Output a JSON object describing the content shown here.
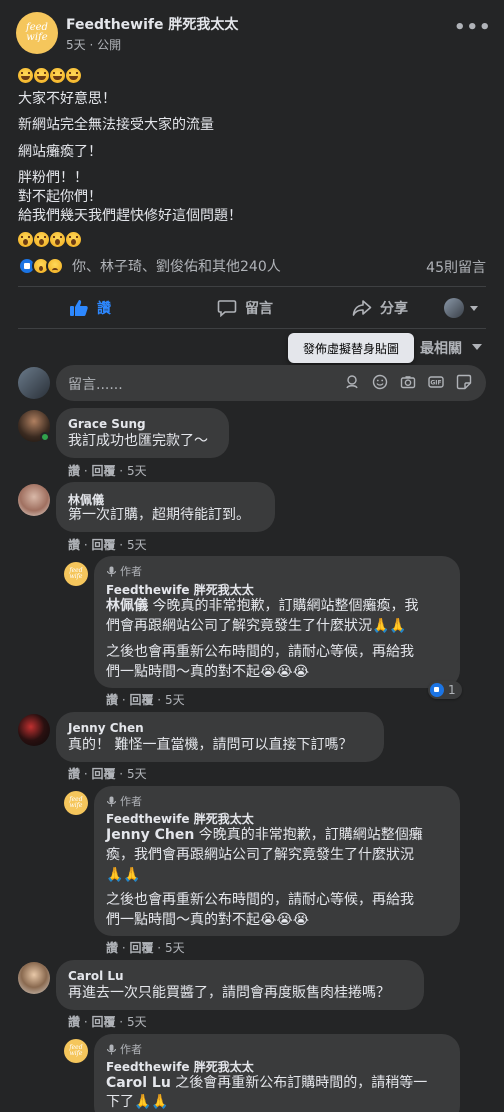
{
  "post": {
    "author": "Feedthewife 胖死我太太",
    "logo_text": [
      "feed",
      "wife"
    ],
    "meta": "5天 · 公開",
    "more": "•••",
    "lines": [
      "大家不好意思！",
      "新網站完全無法接受大家的流量",
      "網站癱瘓了！",
      "胖粉們！！",
      "對不起你們！",
      "給我們幾天我們趕快修好這個問題！"
    ],
    "emoji_top": [
      "laugh-emoji",
      "laugh-emoji",
      "laugh-emoji",
      "laugh-emoji"
    ],
    "emoji_bottom": [
      "wow-emoji",
      "wow-emoji",
      "wow-emoji",
      "wow-emoji"
    ],
    "reactions": {
      "icons": [
        "like-icon",
        "wow-icon",
        "sad-icon"
      ],
      "names": "你、林子琦、劉俊佑和其他240人",
      "comments": "45則留言"
    }
  },
  "actions": {
    "like": "讚",
    "comment": "留言",
    "share": "分享"
  },
  "tooltip": "發佈虛擬替身貼圖",
  "sort_label": "最相關",
  "composer": {
    "placeholder": "留言......"
  },
  "comments": [
    {
      "name": "Grace Sung",
      "text": "我訂成功也匯完款了～",
      "like": "讚",
      "reply": "回覆",
      "time": "5天"
    },
    {
      "name": "林佩儀",
      "text": "第一次訂購，超期待能訂到。",
      "like": "讚",
      "reply": "回覆",
      "time": "5天",
      "reply_item": {
        "badge": "作者",
        "name": "Feedthewife 胖死我太太",
        "mention": "林佩儀",
        "text1": " 今晚真的非常抱歉，訂購網站整個癱瘓，我",
        "text2": "們會再跟網站公司了解究竟發生了什麼狀況🙏🙏",
        "text3": "之後也會再重新公布時間的，請耐心等候，再給我",
        "text4": "們一點時間～真的對不起😭😭😭",
        "like": "讚",
        "reply": "回覆",
        "time": "5天",
        "likes": "1"
      }
    },
    {
      "name": "Jenny Chen",
      "text": "真的！ 難怪一直當機，請問可以直接下訂嗎？",
      "like": "讚",
      "reply": "回覆",
      "time": "5天",
      "reply_item": {
        "badge": "作者",
        "name": "Feedthewife 胖死我太太",
        "mention": "Jenny Chen",
        "text1": " 今晚真的非常抱歉，訂購網站整個癱",
        "text2": "瘓，我們會再跟網站公司了解究竟發生了什麼狀況",
        "text3": "🙏🙏",
        "text4": "之後也會再重新公布時間的，請耐心等候，再給我",
        "text5": "們一點時間～真的對不起😭😭😭",
        "like": "讚",
        "reply": "回覆",
        "time": "5天"
      }
    },
    {
      "name": "Carol Lu",
      "text": "再進去一次只能買醬了，請問會再度販售肉桂捲嗎？",
      "like": "讚",
      "reply": "回覆",
      "time": "5天",
      "reply_item": {
        "badge": "作者",
        "name": "Feedthewife 胖死我太太",
        "mention": "Carol Lu",
        "text1": " 之後會再重新公布訂購時間的，請稍等一",
        "text2": "下了🙏🙏"
      }
    }
  ]
}
